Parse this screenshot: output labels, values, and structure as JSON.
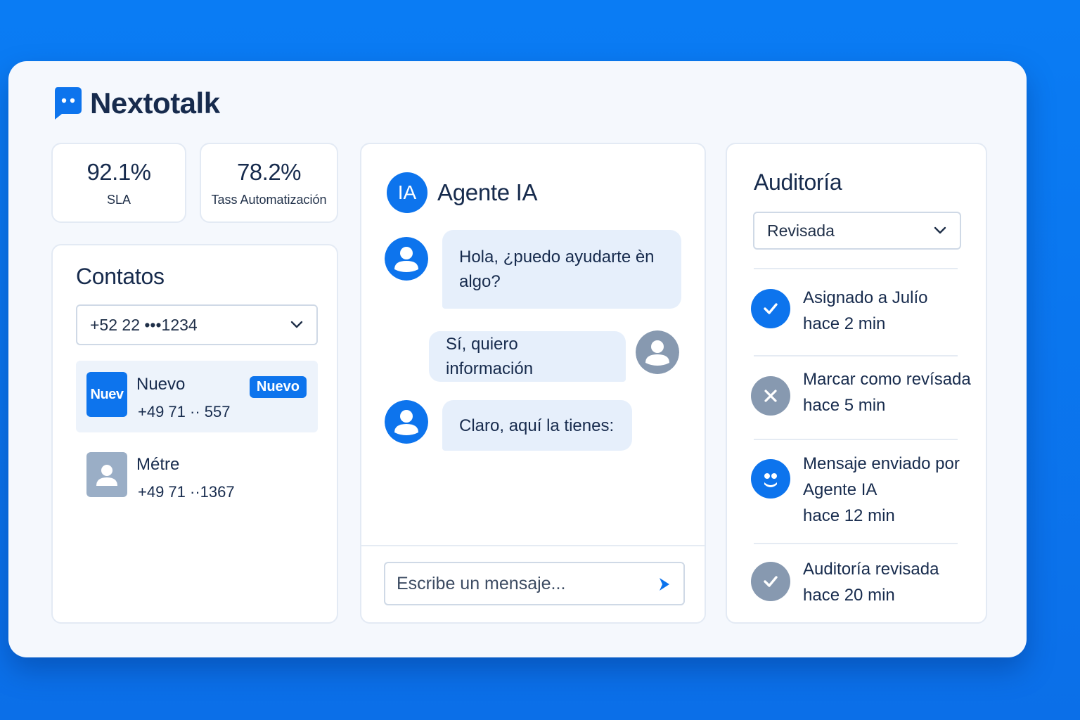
{
  "brand": {
    "name": "Nextotalk"
  },
  "stats": [
    {
      "value": "92.1%",
      "label": "SLA"
    },
    {
      "value": "78.2%",
      "label": "Tass Automatización"
    }
  ],
  "contacts": {
    "title": "Contatos",
    "select_value": "+52 22 •••1234",
    "items": [
      {
        "avatar_text": "Nuev",
        "name": "Nuevo",
        "phone": "+49 71 ·· 557",
        "badge": "Nuevo"
      },
      {
        "name": "Métre",
        "phone": "+49 71 ··1367"
      }
    ]
  },
  "chat": {
    "avatar_text": "IA",
    "title": "Agente IA",
    "messages": [
      {
        "text": "Hola, ¿puedo ayudarte èn algo?",
        "from": "agent"
      },
      {
        "text": "Sí, quiero información",
        "from": "user"
      },
      {
        "text": "Claro, aquí la tienes:",
        "from": "agent"
      }
    ],
    "composer_placeholder": "Escribe un mensaje..."
  },
  "audit": {
    "title": "Auditoría",
    "filter_value": "Revisada",
    "items": [
      {
        "icon": "check-icon",
        "line1": "Asignado a Julío",
        "time": "hace 2 min"
      },
      {
        "icon": "close-icon",
        "line1": "Marcar como revísada",
        "time": "hace 5 min"
      },
      {
        "icon": "bot-face-icon",
        "line1": "Mensaje enviado por",
        "line2": "Agente IA",
        "time": "hace 12 min"
      },
      {
        "icon": "check-icon",
        "line1": "Auditoría revisada",
        "time": "hace 20 min"
      }
    ]
  },
  "colors": {
    "background": "#0a7cf4",
    "accent": "#0d74ed",
    "muted_icon": "#8799b0",
    "bubble": "#e6effb"
  }
}
